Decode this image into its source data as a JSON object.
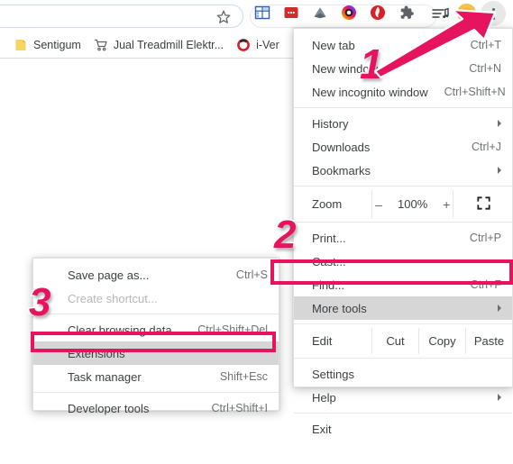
{
  "browser": {
    "omnibox": {
      "value": "",
      "placeholder": ""
    },
    "star_icon": "bookmark-star-icon",
    "toolbar_icons": [
      {
        "name": "grid-extension-icon",
        "title": "Grid extension"
      },
      {
        "name": "red-box-extension-icon",
        "title": "Red extension"
      },
      {
        "name": "kite-extension-icon",
        "title": "Kite extension"
      },
      {
        "name": "camera-extension-icon",
        "title": "Camera extension"
      },
      {
        "name": "opera-extension-icon",
        "title": "Opera extension"
      },
      {
        "name": "puzzle-extensions-icon",
        "title": "Extensions"
      },
      {
        "name": "media-list-icon",
        "title": "Media controls"
      }
    ],
    "avatar": {
      "name": "profile-avatar",
      "title": "Profile"
    },
    "menu_button": {
      "name": "chrome-menu-button",
      "title": "Customize and control Google Chrome"
    },
    "bookmarks": [
      {
        "label": "Sentigum",
        "icon": "page-icon"
      },
      {
        "label": "Jual Treadmill Elektr...",
        "icon": "shopping-cart-icon"
      },
      {
        "label": "i-Ver",
        "icon": "red-ring-icon"
      }
    ]
  },
  "main_menu": {
    "items": [
      {
        "type": "item",
        "label": "New tab",
        "accel": "Ctrl+T"
      },
      {
        "type": "item",
        "label": "New window",
        "accel": "Ctrl+N"
      },
      {
        "type": "item",
        "label": "New incognito window",
        "accel": "Ctrl+Shift+N"
      },
      {
        "type": "sep"
      },
      {
        "type": "item",
        "label": "History",
        "accel": "",
        "submenu": true
      },
      {
        "type": "item",
        "label": "Downloads",
        "accel": "Ctrl+J"
      },
      {
        "type": "item",
        "label": "Bookmarks",
        "accel": "",
        "submenu": true
      },
      {
        "type": "sep"
      },
      {
        "type": "zoom"
      },
      {
        "type": "sep"
      },
      {
        "type": "item",
        "label": "Print...",
        "accel": "Ctrl+P"
      },
      {
        "type": "item",
        "label": "Cast...",
        "accel": ""
      },
      {
        "type": "item",
        "label": "Find...",
        "accel": "Ctrl+F"
      },
      {
        "type": "item",
        "label": "More tools",
        "accel": "",
        "submenu": true,
        "highlight": true
      },
      {
        "type": "sep"
      },
      {
        "type": "edit"
      },
      {
        "type": "sep"
      },
      {
        "type": "item",
        "label": "Settings",
        "accel": ""
      },
      {
        "type": "item",
        "label": "Help",
        "accel": "",
        "submenu": true
      },
      {
        "type": "sep"
      },
      {
        "type": "item",
        "label": "Exit",
        "accel": ""
      }
    ],
    "zoom_row": {
      "label": "Zoom",
      "minus": "–",
      "value": "100%",
      "plus": "+",
      "fullscreen_icon": "fullscreen-icon"
    },
    "edit_row": {
      "label": "Edit",
      "cut": "Cut",
      "copy": "Copy",
      "paste": "Paste"
    }
  },
  "more_tools_menu": {
    "items": [
      {
        "type": "item",
        "label": "Save page as...",
        "accel": "Ctrl+S"
      },
      {
        "type": "item",
        "label": "Create shortcut...",
        "accel": "",
        "disabled": true
      },
      {
        "type": "sep"
      },
      {
        "type": "item",
        "label": "Clear browsing data...",
        "accel": "Ctrl+Shift+Del"
      },
      {
        "type": "item",
        "label": "Extensions",
        "accel": "",
        "highlight": true
      },
      {
        "type": "item",
        "label": "Task manager",
        "accel": "Shift+Esc"
      },
      {
        "type": "sep"
      },
      {
        "type": "item",
        "label": "Developer tools",
        "accel": "Ctrl+Shift+I"
      }
    ]
  },
  "annotations": {
    "accent_color": "#e6145f",
    "step_1": "1",
    "step_2": "2",
    "step_3": "3",
    "arrow": "pointer-arrow"
  }
}
